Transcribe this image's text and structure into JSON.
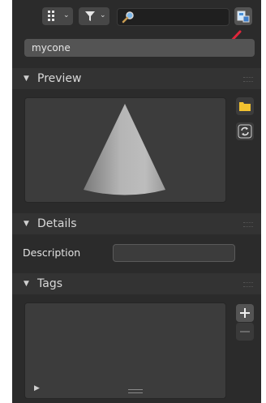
{
  "toolbar": {
    "display_mode_icon": "grid-view-icon",
    "filter_icon": "funnel-filter-icon",
    "search_icon": "magnifier-icon",
    "search_placeholder": "",
    "options_icon": "save-asset-icon"
  },
  "asset_name": "mycone",
  "sections": {
    "preview": "Preview",
    "details": "Details",
    "tags": "Tags"
  },
  "preview": {
    "load_icon": "folder-icon",
    "regenerate_icon": "refresh-icon"
  },
  "details": {
    "description_label": "Description",
    "description_value": ""
  },
  "tags": {
    "add_icon": "plus-icon",
    "remove_icon": "minus-icon"
  },
  "colors": {
    "panel": "#2b2b2b",
    "header": "#333333",
    "field": "#545454",
    "folder": "#f2c230",
    "annotation": "#e0263b"
  }
}
